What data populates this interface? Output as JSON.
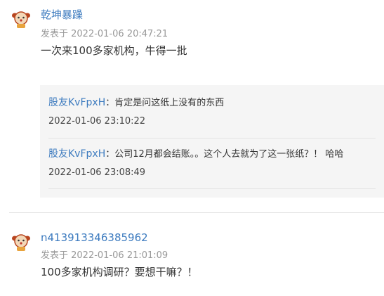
{
  "comments": [
    {
      "author": "乾坤暴躁",
      "meta": "发表于 2022-01-06 20:47:21",
      "text": "一次来100多家机构，牛得一批",
      "avatar_icon": "cartoon-avatar-icon",
      "replies": [
        {
          "user": "股友KvFpxH",
          "text": "：肯定是问这纸上没有的东西",
          "time": "2022-01-06 23:10:22"
        },
        {
          "user": "股友KvFpxH",
          "text": "：公司12月都会结账。。这个人去就为了这一张纸？！ 哈哈",
          "time": "2022-01-06 23:08:49"
        }
      ]
    },
    {
      "author": "n413913346385962",
      "meta": "发表于 2022-01-06 21:01:09",
      "text": "100多家机构调研？要想干嘛？！",
      "avatar_icon": "cartoon-avatar-icon"
    }
  ],
  "colors": {
    "link": "#3d7bbf",
    "meta": "#999999",
    "text": "#333333",
    "reply_bg": "#f5f5f5"
  }
}
